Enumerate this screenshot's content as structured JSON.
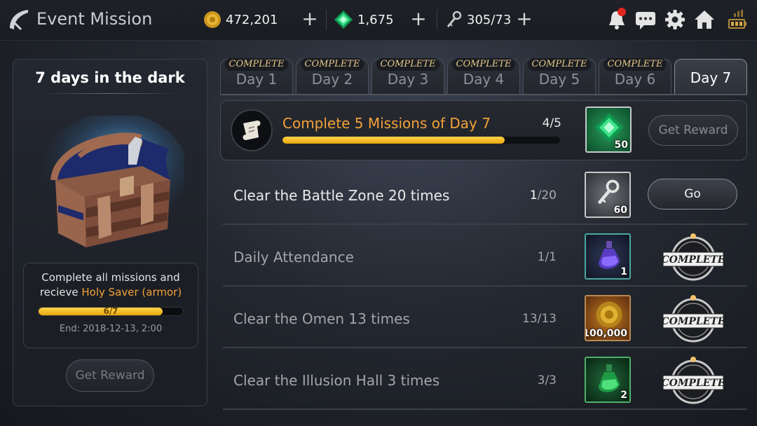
{
  "header": {
    "title": "Event Mission",
    "gold": "472,201",
    "gems": "1,675",
    "keys": "305/73"
  },
  "colors": {
    "accent": "#f3a23a",
    "progress_fill": "#f2be22",
    "notification": "#e2241f"
  },
  "icons": [
    "back-arrow-icon",
    "gold-coin-icon",
    "gem-icon",
    "key-icon",
    "bell-icon",
    "chat-icon",
    "gear-icon",
    "home-icon",
    "signal-battery-icon",
    "scroll-icon",
    "chest-icon",
    "complete-stamp-icon"
  ],
  "left_panel": {
    "title": "7 days in the dark",
    "desc_line1": "Complete all missions and",
    "desc_prefix": "recieve ",
    "desc_highlight": "Holy Saver (armor)",
    "progress_text": "6/7",
    "progress_value": 0.857,
    "end_text": "End: 2018-12-13, 2:00",
    "button": "Get Reward"
  },
  "tabs": [
    {
      "label": "Day 1",
      "badge": "COMPLETE"
    },
    {
      "label": "Day 2",
      "badge": "COMPLETE"
    },
    {
      "label": "Day 3",
      "badge": "COMPLETE"
    },
    {
      "label": "Day 4",
      "badge": "COMPLETE"
    },
    {
      "label": "Day 5",
      "badge": "COMPLETE"
    },
    {
      "label": "Day 6",
      "badge": "COMPLETE"
    },
    {
      "label": "Day 7",
      "badge": ""
    }
  ],
  "main_mission": {
    "name": "Complete 5 Missions of Day 7",
    "progress": "4/5",
    "progress_value": 0.8,
    "reward_qty": "50",
    "button": "Get Reward"
  },
  "missions": [
    {
      "name": "Clear the Battle Zone 20 times",
      "progress_done": "1",
      "progress_total": "/20",
      "reward_qty": "60",
      "button": "Go"
    },
    {
      "name": "Daily Attendance",
      "progress": "1/1",
      "reward_qty": "1",
      "stamp": "COMPLETE"
    },
    {
      "name": "Clear the Omen 13 times",
      "progress": "13/13",
      "reward_qty": "100,000",
      "stamp": "COMPLETE"
    },
    {
      "name": "Clear the Illusion Hall 3 times",
      "progress": "3/3",
      "reward_qty": "2",
      "stamp": "COMPLETE"
    }
  ]
}
